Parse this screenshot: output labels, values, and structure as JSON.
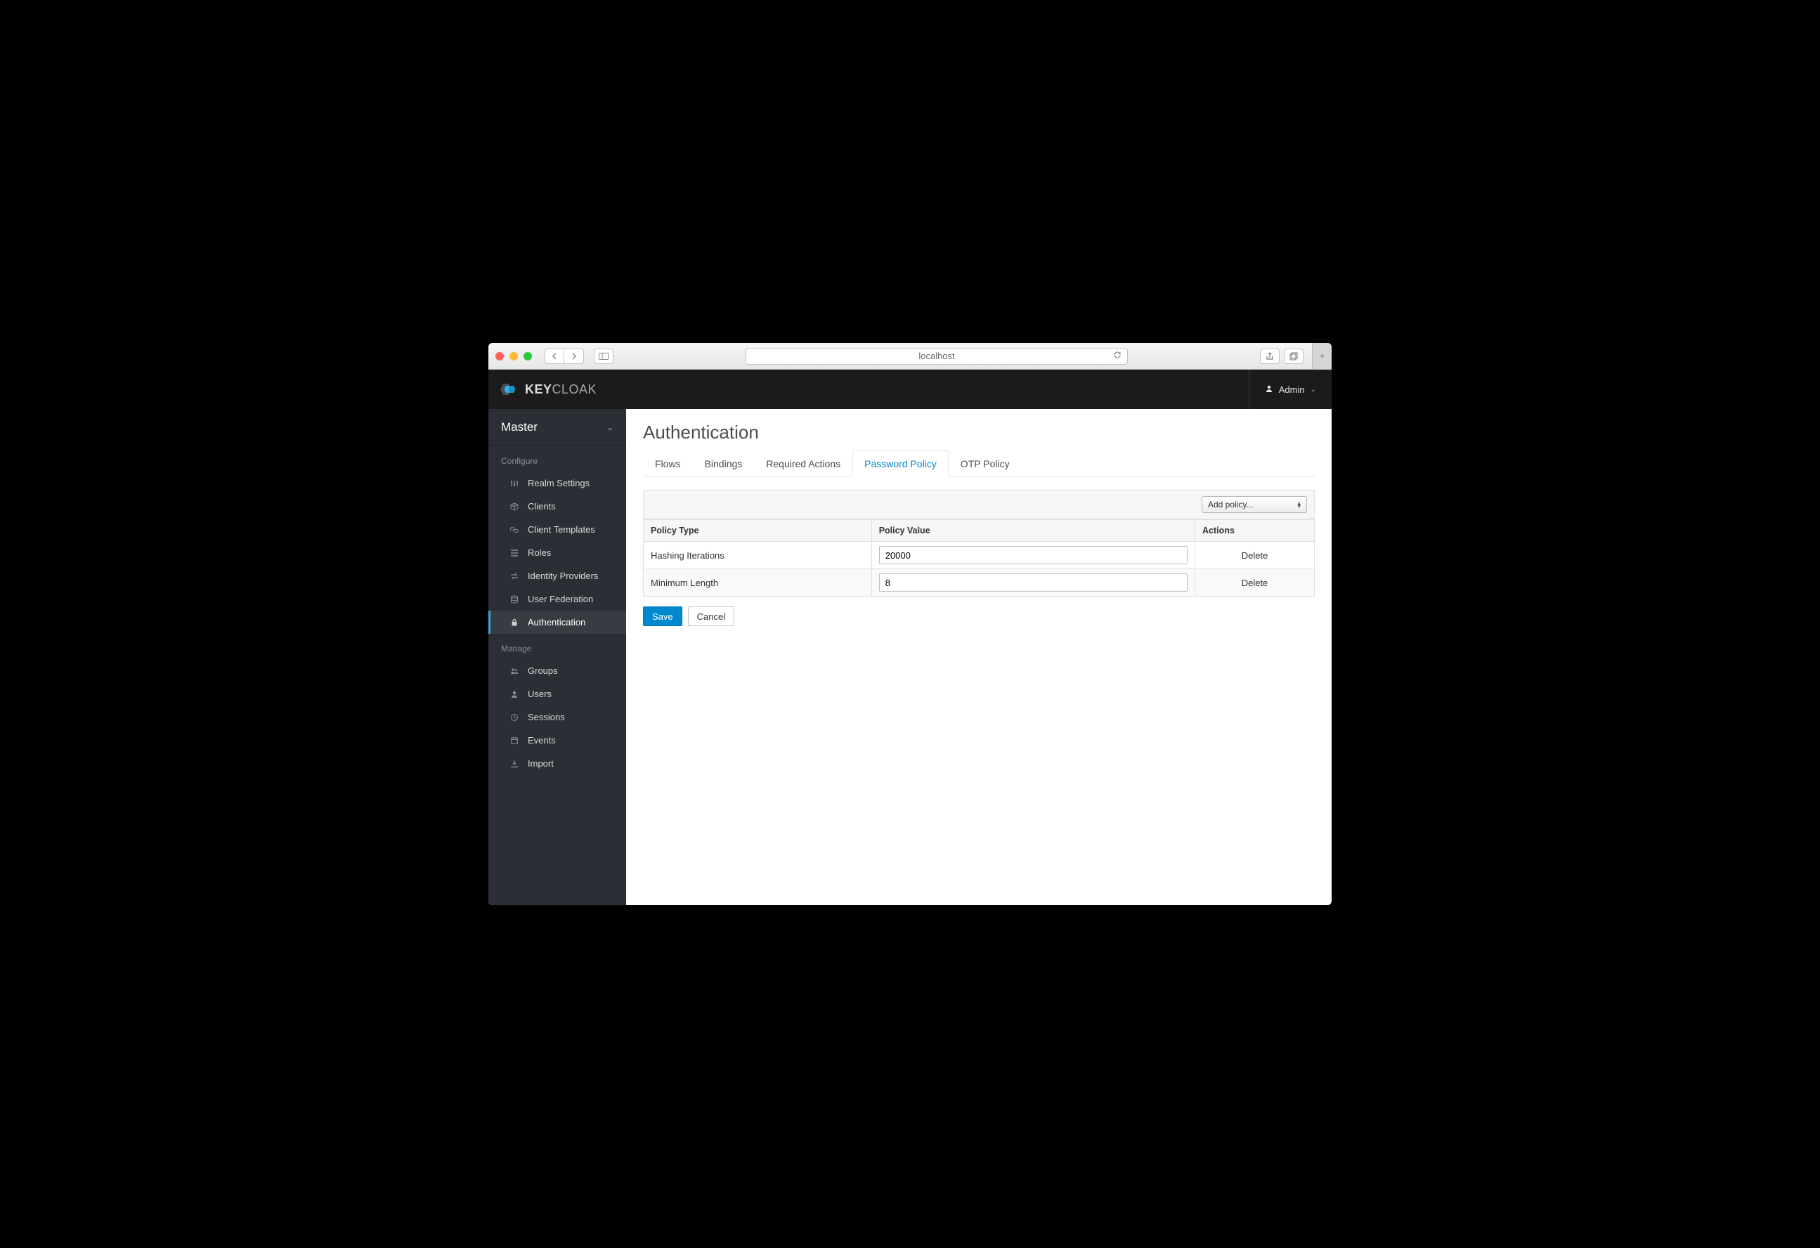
{
  "browser": {
    "url": "localhost"
  },
  "header": {
    "brand1": "KEY",
    "brand2": "CLOAK",
    "user": "Admin"
  },
  "sidebar": {
    "realm": "Master",
    "section_configure": "Configure",
    "section_manage": "Manage",
    "configure": [
      {
        "label": "Realm Settings"
      },
      {
        "label": "Clients"
      },
      {
        "label": "Client Templates"
      },
      {
        "label": "Roles"
      },
      {
        "label": "Identity Providers"
      },
      {
        "label": "User Federation"
      },
      {
        "label": "Authentication"
      }
    ],
    "manage": [
      {
        "label": "Groups"
      },
      {
        "label": "Users"
      },
      {
        "label": "Sessions"
      },
      {
        "label": "Events"
      },
      {
        "label": "Import"
      }
    ]
  },
  "page": {
    "title": "Authentication",
    "tabs": {
      "flows": "Flows",
      "bindings": "Bindings",
      "required_actions": "Required Actions",
      "password_policy": "Password Policy",
      "otp_policy": "OTP Policy"
    },
    "add_policy": "Add policy...",
    "columns": {
      "type": "Policy Type",
      "value": "Policy Value",
      "actions": "Actions"
    },
    "rows": [
      {
        "type": "Hashing Iterations",
        "value": "20000",
        "delete": "Delete"
      },
      {
        "type": "Minimum Length",
        "value": "8",
        "delete": "Delete"
      }
    ],
    "save": "Save",
    "cancel": "Cancel"
  }
}
